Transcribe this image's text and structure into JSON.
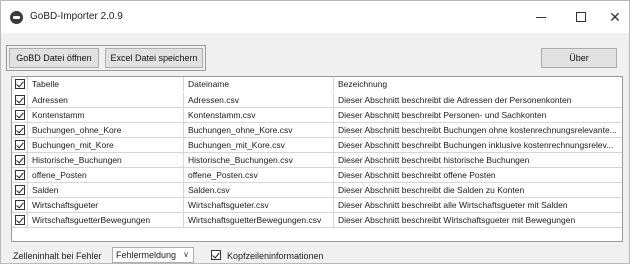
{
  "window": {
    "title": "GoBD-Importer 2.0.9",
    "icon": "app-logo-icon",
    "minimize_icon": "minimize-icon",
    "maximize_icon": "maximize-icon",
    "close_icon": "close-icon"
  },
  "toolbar": {
    "open_label": "GoBD Datei öffnen",
    "save_label": "Excel Datei speichern",
    "about_label": "Über"
  },
  "table": {
    "columns": [
      "Tabelle",
      "Dateiname",
      "Bezeichnung"
    ],
    "header_checked": true,
    "rows": [
      {
        "checked": true,
        "table": "Adressen",
        "file": "Adressen.csv",
        "desc": "Dieser Abschnitt beschreibt die Adressen der Personenkonten"
      },
      {
        "checked": true,
        "table": "Kontenstamm",
        "file": "Kontenstamm.csv",
        "desc": "Dieser Abschnitt beschreibt Personen- und Sachkonten"
      },
      {
        "checked": true,
        "table": "Buchungen_ohne_Kore",
        "file": "Buchungen_ohne_Kore.csv",
        "desc": "Dieser Abschnitt beschreibt Buchungen ohne kostenrechnungsrelevante..."
      },
      {
        "checked": true,
        "table": "Buchungen_mit_Kore",
        "file": "Buchungen_mit_Kore.csv",
        "desc": "Dieser Abschnitt beschreibt Buchungen inklusive kostenrechnungsrelev..."
      },
      {
        "checked": true,
        "table": "Historische_Buchungen",
        "file": "Historische_Buchungen.csv",
        "desc": "Dieser Abschnitt beschreibt historische Buchungen"
      },
      {
        "checked": true,
        "table": "offene_Posten",
        "file": "offene_Posten.csv",
        "desc": "Dieser Abschnitt beschreibt offene Posten"
      },
      {
        "checked": true,
        "table": "Salden",
        "file": "Salden.csv",
        "desc": "Dieser Abschnitt beschreibt die Salden zu Konten"
      },
      {
        "checked": true,
        "table": "Wirtschaftsgueter",
        "file": "Wirtschaftsgueter.csv",
        "desc": "Dieser Abschnitt beschreibt alle Wirtschaftsgueter mit Salden"
      },
      {
        "checked": true,
        "table": "WirtschaftsguetterBewegungen",
        "file": "WirtschaftsguetterBewegungen.csv",
        "desc": "Dieser Abschnitt beschreibt Wirtschaftsgueter mit Bewegungen"
      }
    ]
  },
  "footer": {
    "error_label": "Zelleninhalt bei Fehler",
    "error_select_value": "Fehlermeldung",
    "header_info_label": "Kopfzeileninformationen",
    "header_info_checked": true
  }
}
